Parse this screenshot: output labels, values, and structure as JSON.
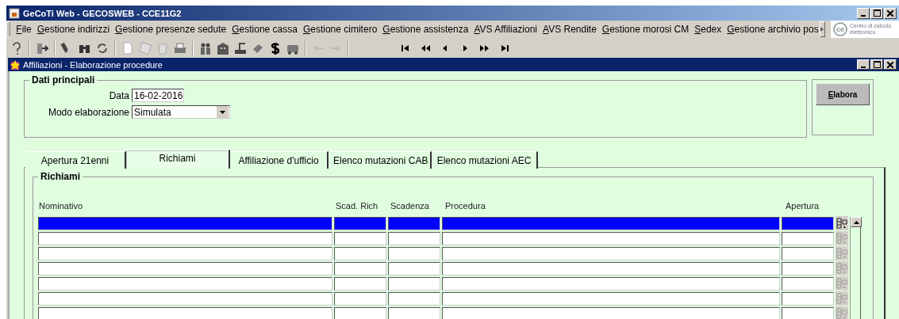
{
  "window": {
    "title": "GeCoTi Web - GECOSWEB - CCE11G2"
  },
  "menu": [
    "File",
    "Gestione indirizzi",
    "Gestione presenze sedute",
    "Gestione cassa",
    "Gestione cimitero",
    "Gestione assistenza",
    "AVS Affiliazioni",
    "AVS Rendite",
    "Gestione morosi CM",
    "Sedex",
    "Gestione archivio pos"
  ],
  "logo": {
    "mark": "ce",
    "caption": "Centro di calcolo elettronico"
  },
  "inner_window": {
    "title": "Affiliazioni - Elaborazione procedure"
  },
  "dati_principali": {
    "title": "Dati principali",
    "fields": [
      {
        "label": "Data",
        "value": "16-02-2016",
        "kind": "text"
      },
      {
        "label": "Modo elaborazione",
        "value": "Simulata",
        "kind": "dropdown"
      }
    ]
  },
  "buttons": [
    "Elabora"
  ],
  "tabs": [
    {
      "label": "Apertura 21enni",
      "selected": false
    },
    {
      "label": "Richiami",
      "selected": true
    },
    {
      "label": "Affiliazione d'ufficio",
      "selected": false
    },
    {
      "label": "Elenco mutazioni CAB",
      "selected": false
    },
    {
      "label": "Elenco mutazioni AEC",
      "selected": false
    }
  ],
  "richiami": {
    "title": "Richiami",
    "columns": [
      "Nominativo",
      "Scad. Rich",
      "Scadenza",
      "Procedura",
      "Apertura"
    ],
    "rows": [
      {
        "selected": true
      },
      {
        "selected": false
      },
      {
        "selected": false
      },
      {
        "selected": false
      },
      {
        "selected": false
      },
      {
        "selected": false
      },
      {
        "selected": false
      }
    ]
  }
}
